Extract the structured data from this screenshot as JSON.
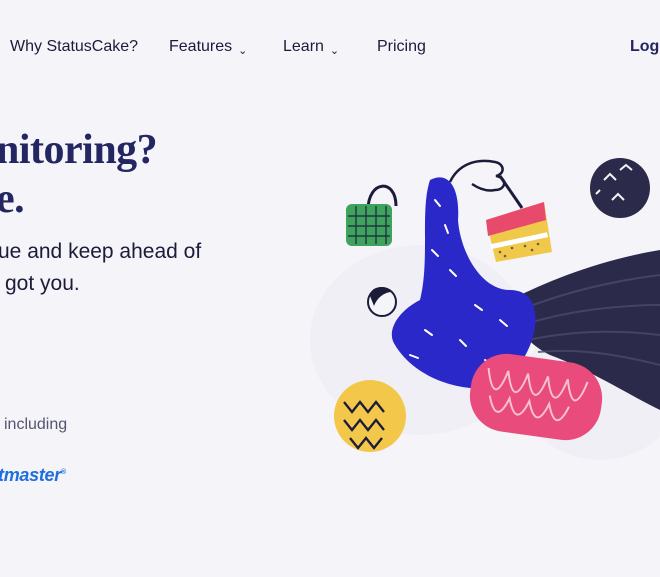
{
  "nav": {
    "items": [
      {
        "label": "Why StatusCake?",
        "has_dropdown": false
      },
      {
        "label": "Features",
        "has_dropdown": true
      },
      {
        "label": "Learn",
        "has_dropdown": true
      },
      {
        "label": "Pricing",
        "has_dropdown": false
      }
    ],
    "caret": "⌄",
    "login": "Logi"
  },
  "hero": {
    "headline_line1": "nitoring?",
    "headline_line2": "e.",
    "sub_line1": "ue and keep ahead of",
    "sub_line2": "got you."
  },
  "trusted": {
    "text": "including",
    "logo_text": "tmaster",
    "logo_mark": "®",
    "logo_color": "#1f6fdc"
  },
  "colors": {
    "navy": "#232660",
    "background": "#f4f4f9"
  },
  "illustration": {
    "name": "person-falling-with-cake-illustration"
  }
}
